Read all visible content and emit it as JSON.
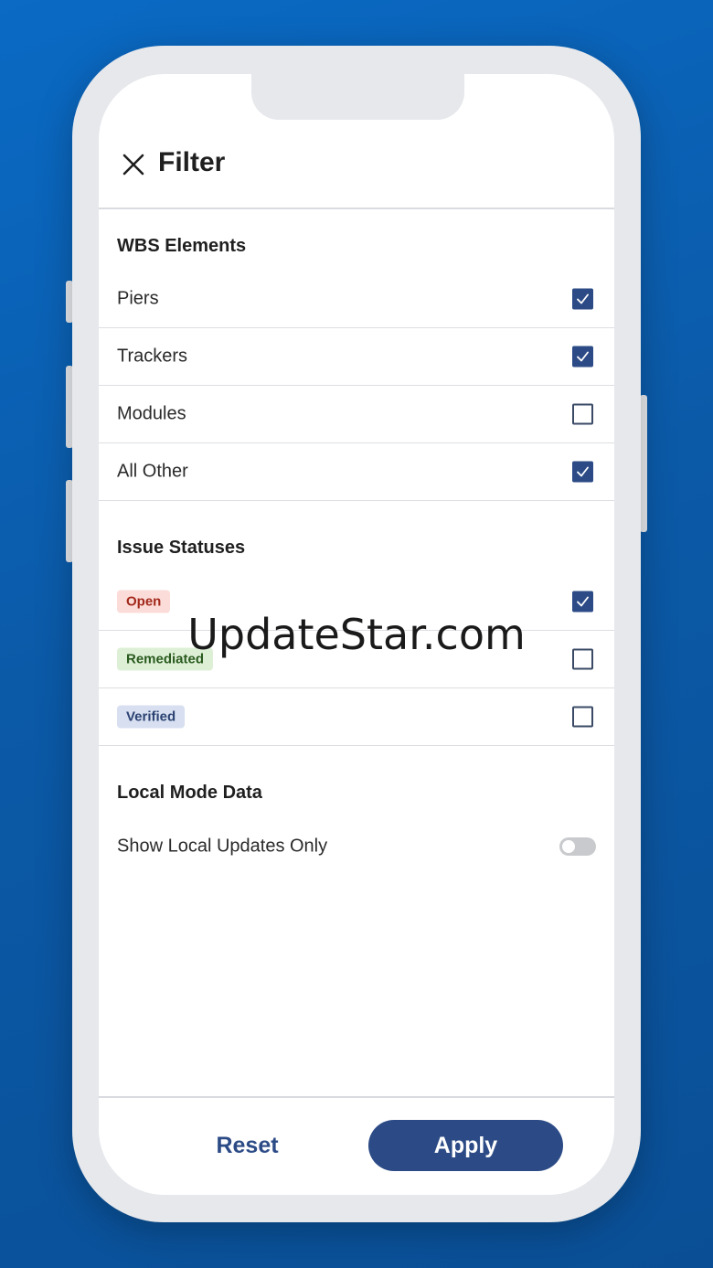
{
  "header": {
    "title": "Filter"
  },
  "wbs": {
    "title": "WBS Elements",
    "items": [
      {
        "label": "Piers",
        "checked": true
      },
      {
        "label": "Trackers",
        "checked": true
      },
      {
        "label": "Modules",
        "checked": false
      },
      {
        "label": "All Other",
        "checked": true
      }
    ]
  },
  "statuses": {
    "title": "Issue Statuses",
    "items": [
      {
        "label": "Open",
        "checked": true,
        "color": "#a3281b"
      },
      {
        "label": "Remediated",
        "checked": false,
        "color": "#2a5a1e"
      },
      {
        "label": "Verified",
        "checked": false,
        "color": "#2b4272"
      }
    ]
  },
  "local": {
    "title": "Local Mode Data",
    "toggle_label": "Show Local Updates Only",
    "toggle_on": false
  },
  "footer": {
    "reset_label": "Reset",
    "apply_label": "Apply"
  },
  "watermark": "UpdateStar.com",
  "colors": {
    "accent": "#2c4b86",
    "background": "#0b5aa8"
  }
}
